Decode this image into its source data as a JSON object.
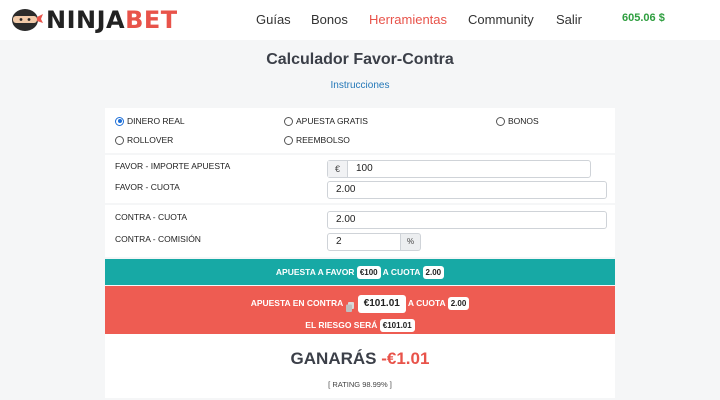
{
  "header": {
    "logo_prefix": "NINJA",
    "logo_suffix": "BET",
    "nav": [
      "Guías",
      "Bonos",
      "Herramientas",
      "Community",
      "Salir"
    ],
    "active_nav": "Herramientas",
    "balance": "605.06 $"
  },
  "page": {
    "title": "Calculador Favor-Contra",
    "instructions_link": "Instrucciones"
  },
  "bet_types": [
    {
      "label": "DINERO REAL",
      "checked": true
    },
    {
      "label": "APUESTA GRATIS",
      "checked": false
    },
    {
      "label": "BONOS",
      "checked": false
    },
    {
      "label": "ROLLOVER",
      "checked": false
    },
    {
      "label": "REEMBOLSO",
      "checked": false
    }
  ],
  "favor": {
    "stake_label": "FAVOR - IMPORTE APUESTA",
    "currency": "€",
    "stake_value": "100",
    "odds_label": "FAVOR - CUOTA",
    "odds_value": "2.00"
  },
  "contra": {
    "odds_label": "CONTRA - CUOTA",
    "odds_value": "2.00",
    "commission_label": "CONTRA - COMISIÓN",
    "commission_value": "2",
    "commission_unit": "%"
  },
  "summary": {
    "favor_prefix": "APUESTA A FAVOR",
    "favor_amount": "€100",
    "favor_odds_prefix": "A CUOTA",
    "favor_odds": "2.00",
    "contra_prefix": "APUESTA EN CONTRA",
    "contra_amount": "€101.01",
    "contra_odds_prefix": "A CUOTA",
    "contra_odds": "2.00",
    "risk_prefix": "EL RIESGO SERÁ",
    "risk_amount": "€101.01"
  },
  "result": {
    "label": "GANARÁS",
    "amount": "-€1.01",
    "rating": "[ RATING 98.99% ]"
  },
  "colors": {
    "brand_red": "#e8534a",
    "teal": "#17a9a5",
    "red_band": "#ee5c52",
    "balance_green": "#2e9e3f"
  }
}
